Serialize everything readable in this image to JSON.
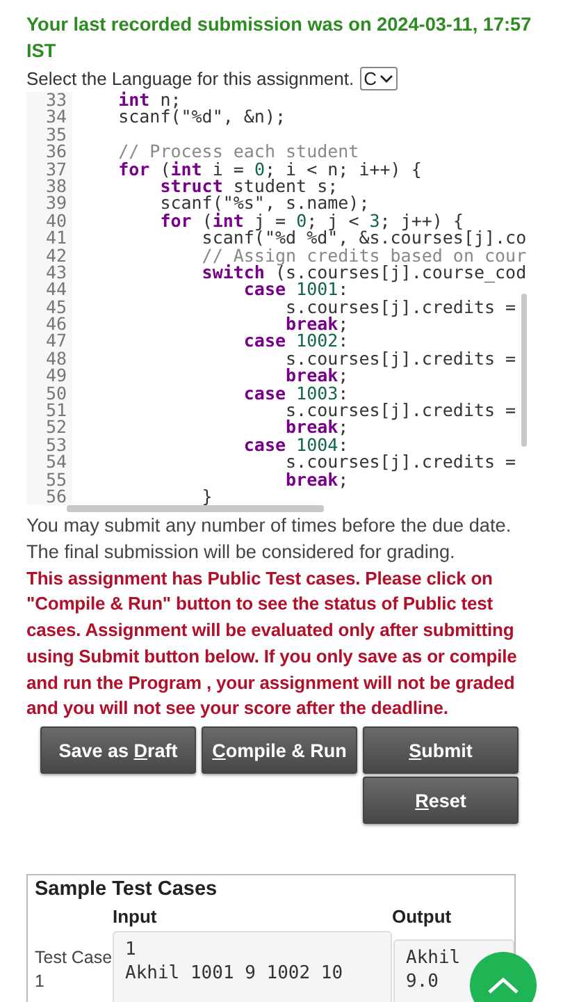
{
  "submission_notice": "Your last recorded submission was on 2024-03-11, 17:57 IST",
  "language_prompt": "Select the Language for this assignment.",
  "language_select": {
    "value": "C"
  },
  "editor": {
    "lines": [
      {
        "number": "33",
        "segments": [
          {
            "kind": "keyword",
            "text": "    int"
          },
          {
            "kind": "plain",
            "text": " n;"
          }
        ]
      },
      {
        "number": "34",
        "segments": [
          {
            "kind": "plain",
            "text": "    scanf(\"%d\", &n);"
          }
        ]
      },
      {
        "number": "35"
      },
      {
        "number": "36",
        "segments": [
          {
            "kind": "comment",
            "text": "    // Process each student"
          }
        ]
      },
      {
        "number": "37",
        "segments": [
          {
            "kind": "keyword",
            "text": "    for"
          },
          {
            "kind": "plain",
            "text": " ("
          },
          {
            "kind": "keyword",
            "text": "int"
          },
          {
            "kind": "plain",
            "text": " i = "
          },
          {
            "kind": "number",
            "text": "0"
          },
          {
            "kind": "plain",
            "text": "; i < n; i++) {"
          }
        ]
      },
      {
        "number": "38",
        "segments": [
          {
            "kind": "keyword",
            "text": "        struct"
          },
          {
            "kind": "plain",
            "text": " student s;"
          }
        ]
      },
      {
        "number": "39",
        "segments": [
          {
            "kind": "plain",
            "text": "        scanf(\"%s\", s.name);"
          }
        ]
      },
      {
        "number": "40",
        "segments": [
          {
            "kind": "keyword",
            "text": "        for"
          },
          {
            "kind": "plain",
            "text": " ("
          },
          {
            "kind": "keyword",
            "text": "int"
          },
          {
            "kind": "plain",
            "text": " j = "
          },
          {
            "kind": "number",
            "text": "0"
          },
          {
            "kind": "plain",
            "text": "; j < "
          },
          {
            "kind": "number",
            "text": "3"
          },
          {
            "kind": "plain",
            "text": "; j++) {"
          }
        ]
      },
      {
        "number": "41",
        "segments": [
          {
            "kind": "plain",
            "text": "            scanf(\"%d %d\", &s.courses[j].co"
          }
        ]
      },
      {
        "number": "42",
        "segments": [
          {
            "kind": "comment",
            "text": "            // Assign credits based on cour"
          }
        ]
      },
      {
        "number": "43",
        "segments": [
          {
            "kind": "keyword",
            "text": "            switch"
          },
          {
            "kind": "plain",
            "text": " (s.courses[j].course_cod"
          }
        ]
      },
      {
        "number": "44",
        "segments": [
          {
            "kind": "keyword",
            "text": "                case"
          },
          {
            "kind": "number",
            "text": " 1001"
          },
          {
            "kind": "plain",
            "text": ":"
          }
        ]
      },
      {
        "number": "45",
        "segments": [
          {
            "kind": "plain",
            "text": "                    s.courses[j].credits ="
          }
        ]
      },
      {
        "number": "46",
        "segments": [
          {
            "kind": "keyword",
            "text": "                    break"
          },
          {
            "kind": "plain",
            "text": ";"
          }
        ]
      },
      {
        "number": "47",
        "segments": [
          {
            "kind": "keyword",
            "text": "                case"
          },
          {
            "kind": "number",
            "text": " 1002"
          },
          {
            "kind": "plain",
            "text": ":"
          }
        ]
      },
      {
        "number": "48",
        "segments": [
          {
            "kind": "plain",
            "text": "                    s.courses[j].credits ="
          }
        ]
      },
      {
        "number": "49",
        "segments": [
          {
            "kind": "keyword",
            "text": "                    break"
          },
          {
            "kind": "plain",
            "text": ";"
          }
        ]
      },
      {
        "number": "50",
        "segments": [
          {
            "kind": "keyword",
            "text": "                case"
          },
          {
            "kind": "number",
            "text": " 1003"
          },
          {
            "kind": "plain",
            "text": ":"
          }
        ]
      },
      {
        "number": "51",
        "segments": [
          {
            "kind": "plain",
            "text": "                    s.courses[j].credits ="
          }
        ]
      },
      {
        "number": "52",
        "segments": [
          {
            "kind": "keyword",
            "text": "                    break"
          },
          {
            "kind": "plain",
            "text": ";"
          }
        ]
      },
      {
        "number": "53",
        "segments": [
          {
            "kind": "keyword",
            "text": "                case"
          },
          {
            "kind": "number",
            "text": " 1004"
          },
          {
            "kind": "plain",
            "text": ":"
          }
        ]
      },
      {
        "number": "54",
        "segments": [
          {
            "kind": "plain",
            "text": "                    s.courses[j].credits ="
          }
        ]
      },
      {
        "number": "55",
        "segments": [
          {
            "kind": "keyword",
            "text": "                    break"
          },
          {
            "kind": "plain",
            "text": ";"
          }
        ]
      },
      {
        "number": "56",
        "segments": [
          {
            "kind": "plain",
            "text": "            }"
          }
        ]
      }
    ]
  },
  "notes": [
    "You may submit any number of times before the due date.",
    "The final submission will be considered for grading."
  ],
  "warning": "This assignment has Public Test cases. Please click on \"Compile & Run\" button to see the status of Public test cases. Assignment will be evaluated only after submitting using Submit button below. If you only save as or compile and run the Program , your assignment will not be graded and you will not see your score after the deadline.",
  "buttons": [
    {
      "before": "Save as ",
      "key": "D",
      "after": "raft"
    },
    {
      "key": "C",
      "after": "ompile & Run"
    },
    {
      "key": "S",
      "after": "ubmit"
    },
    {
      "key": "R",
      "after": "eset"
    }
  ],
  "test_cases": {
    "title": "Sample Test Cases",
    "columns": [
      "Input",
      "Output"
    ],
    "rows": [
      {
        "label": "Test Case 1",
        "input": "1\nAkhil 1001 9 1002 10",
        "output": "Akhil\n9.0"
      }
    ]
  }
}
